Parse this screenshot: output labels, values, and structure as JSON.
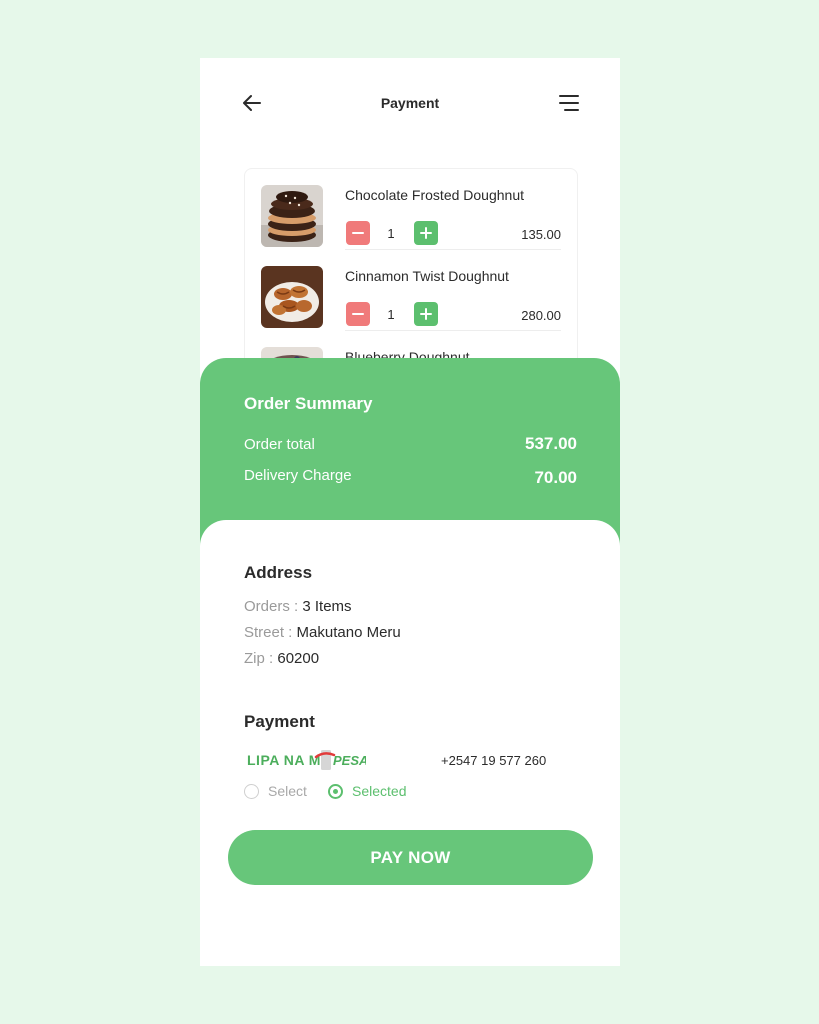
{
  "header": {
    "title": "Payment",
    "back_icon": "arrow-left-icon",
    "menu_icon": "menu-lines-icon"
  },
  "cart": {
    "items": [
      {
        "name": "Chocolate Frosted Doughnut",
        "quantity": "1",
        "price": "135.00"
      },
      {
        "name": "Cinnamon Twist Doughnut",
        "quantity": "1",
        "price": "280.00"
      },
      {
        "name": "Blueberry Doughnut",
        "quantity": "",
        "price": ""
      }
    ]
  },
  "summary": {
    "title": "Order Summary",
    "order_total_label": "Order total",
    "order_total_value": "537.00",
    "delivery_label": "Delivery Charge",
    "delivery_value": "70.00"
  },
  "address": {
    "title": "Address",
    "orders_key": "Orders :",
    "orders_value": "3 Items",
    "street_key": "Street :",
    "street_value": "Makutano Meru",
    "zip_key": "Zip :",
    "zip_value": "60200"
  },
  "payment": {
    "title": "Payment",
    "provider_logo_text": "LIPA NA M-PESA",
    "phone": "+2547 19 577 260",
    "option_unselected": "Select",
    "option_selected": "Selected",
    "pay_button": "PAY NOW"
  },
  "colors": {
    "accent": "#67c67a",
    "minus": "#f07a7a",
    "background": "#e6f8ea"
  }
}
